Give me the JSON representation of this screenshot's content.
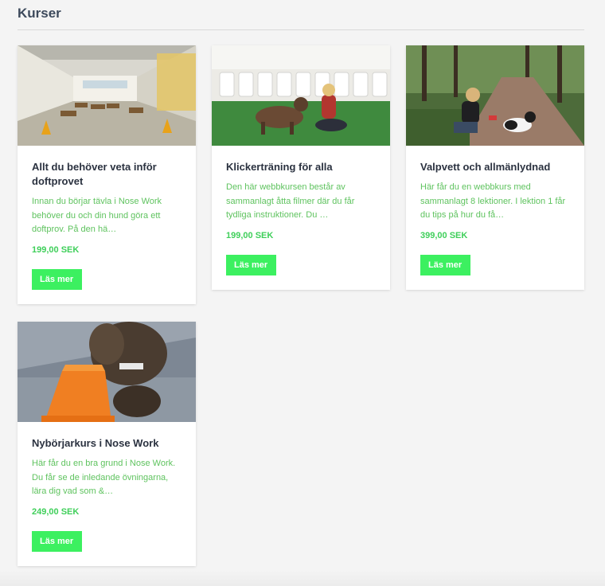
{
  "page": {
    "title": "Kurser"
  },
  "courses": [
    {
      "title": "Allt du behöver veta inför doftprovet",
      "excerpt": "Innan du börjar tävla i Nose Work behöver du och din hund göra ett doftprov. På den hä…",
      "price": "199,00 SEK",
      "button": "Läs mer",
      "image": "training-hall-with-cones"
    },
    {
      "title": "Klickerträning för alla",
      "excerpt": "Den här webbkursen består av sammanlagt åtta filmer där du får tydliga instruktioner. Du …",
      "price": "199,00 SEK",
      "button": "Läs mer",
      "image": "woman-training-dog-indoors"
    },
    {
      "title": "Valpvett och allmänlydnad",
      "excerpt": "Här får du en webbkurs med sammanlagt 8 lektioner. I lektion 1 får du tips på hur du få…",
      "price": "399,00 SEK",
      "button": "Läs mer",
      "image": "woman-with-puppy-forest-path"
    },
    {
      "title": "Nybörjarkurs i Nose Work",
      "excerpt": "Här får du en bra grund i Nose Work. Du får se de inledande övningarna, lära dig vad som &…",
      "price": "249,00 SEK",
      "button": "Läs mer",
      "image": "dog-sniffing-orange-cone"
    }
  ],
  "colors": {
    "accent": "#3cf060",
    "excerpt": "#5fc35f",
    "price": "#3fcf5a",
    "title": "#2b3240"
  }
}
